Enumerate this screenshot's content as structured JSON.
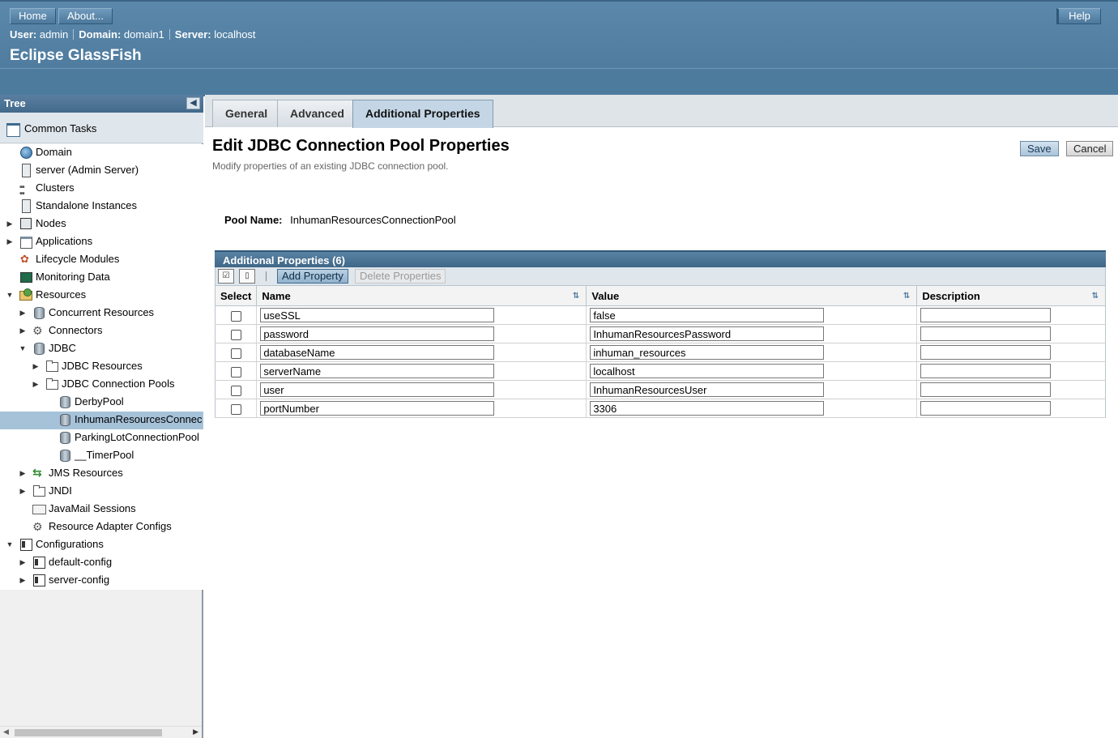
{
  "masthead": {
    "home_label": "Home",
    "about_label": "About...",
    "help_label": "Help",
    "user_label": "User:",
    "user_value": "admin",
    "domain_label": "Domain:",
    "domain_value": "domain1",
    "server_label": "Server:",
    "server_value": "localhost",
    "brand": "Eclipse GlassFish"
  },
  "tree": {
    "title": "Tree",
    "common_tasks": "Common Tasks",
    "nodes": [
      {
        "label": "Domain",
        "icon": "globe-icon"
      },
      {
        "label": "server (Admin Server)",
        "icon": "server-icon"
      },
      {
        "label": "Clusters",
        "icon": "cluster-icon"
      },
      {
        "label": "Standalone Instances",
        "icon": "server-icon"
      },
      {
        "label": "Nodes",
        "icon": "nodes-icon"
      },
      {
        "label": "Applications",
        "icon": "application-icon"
      },
      {
        "label": "Lifecycle Modules",
        "icon": "lifecycle-icon"
      },
      {
        "label": "Monitoring Data",
        "icon": "monitor-icon"
      },
      {
        "label": "Resources",
        "icon": "resources-icon"
      },
      {
        "label": "Concurrent Resources",
        "icon": "database-icon"
      },
      {
        "label": "Connectors",
        "icon": "connector-icon"
      },
      {
        "label": "JDBC",
        "icon": "database-icon"
      },
      {
        "label": "JDBC Resources",
        "icon": "folder-icon"
      },
      {
        "label": "JDBC Connection Pools",
        "icon": "folder-icon"
      },
      {
        "label": "DerbyPool",
        "icon": "database-icon"
      },
      {
        "label": "InhumanResourcesConnec",
        "icon": "database-icon"
      },
      {
        "label": "ParkingLotConnectionPool",
        "icon": "database-icon"
      },
      {
        "label": "__TimerPool",
        "icon": "database-icon"
      },
      {
        "label": "JMS Resources",
        "icon": "jms-icon"
      },
      {
        "label": "JNDI",
        "icon": "folder-icon"
      },
      {
        "label": "JavaMail Sessions",
        "icon": "mail-icon"
      },
      {
        "label": "Resource Adapter Configs",
        "icon": "connector-icon"
      },
      {
        "label": "Configurations",
        "icon": "config-icon"
      },
      {
        "label": "default-config",
        "icon": "config-icon"
      },
      {
        "label": "server-config",
        "icon": "config-icon"
      }
    ]
  },
  "tabs": {
    "general": "General",
    "advanced": "Advanced",
    "additional": "Additional Properties",
    "active": "Additional Properties"
  },
  "page": {
    "title": "Edit JDBC Connection Pool Properties",
    "help": "Modify properties of an existing JDBC connection pool.",
    "save_label": "Save",
    "cancel_label": "Cancel",
    "pool_name_label": "Pool Name:",
    "pool_name_value": "InhumanResourcesConnectionPool"
  },
  "properties_table": {
    "title": "Additional Properties (6)",
    "add_label": "Add Property",
    "delete_label": "Delete Properties",
    "columns": {
      "select": "Select",
      "name": "Name",
      "value": "Value",
      "description": "Description"
    },
    "rows": [
      {
        "name": "useSSL",
        "value": "false",
        "description": ""
      },
      {
        "name": "password",
        "value": "InhumanResourcesPassword",
        "description": ""
      },
      {
        "name": "databaseName",
        "value": "inhuman_resources",
        "description": ""
      },
      {
        "name": "serverName",
        "value": "localhost",
        "description": ""
      },
      {
        "name": "user",
        "value": "InhumanResourcesUser",
        "description": ""
      },
      {
        "name": "portNumber",
        "value": "3306",
        "description": ""
      }
    ]
  }
}
